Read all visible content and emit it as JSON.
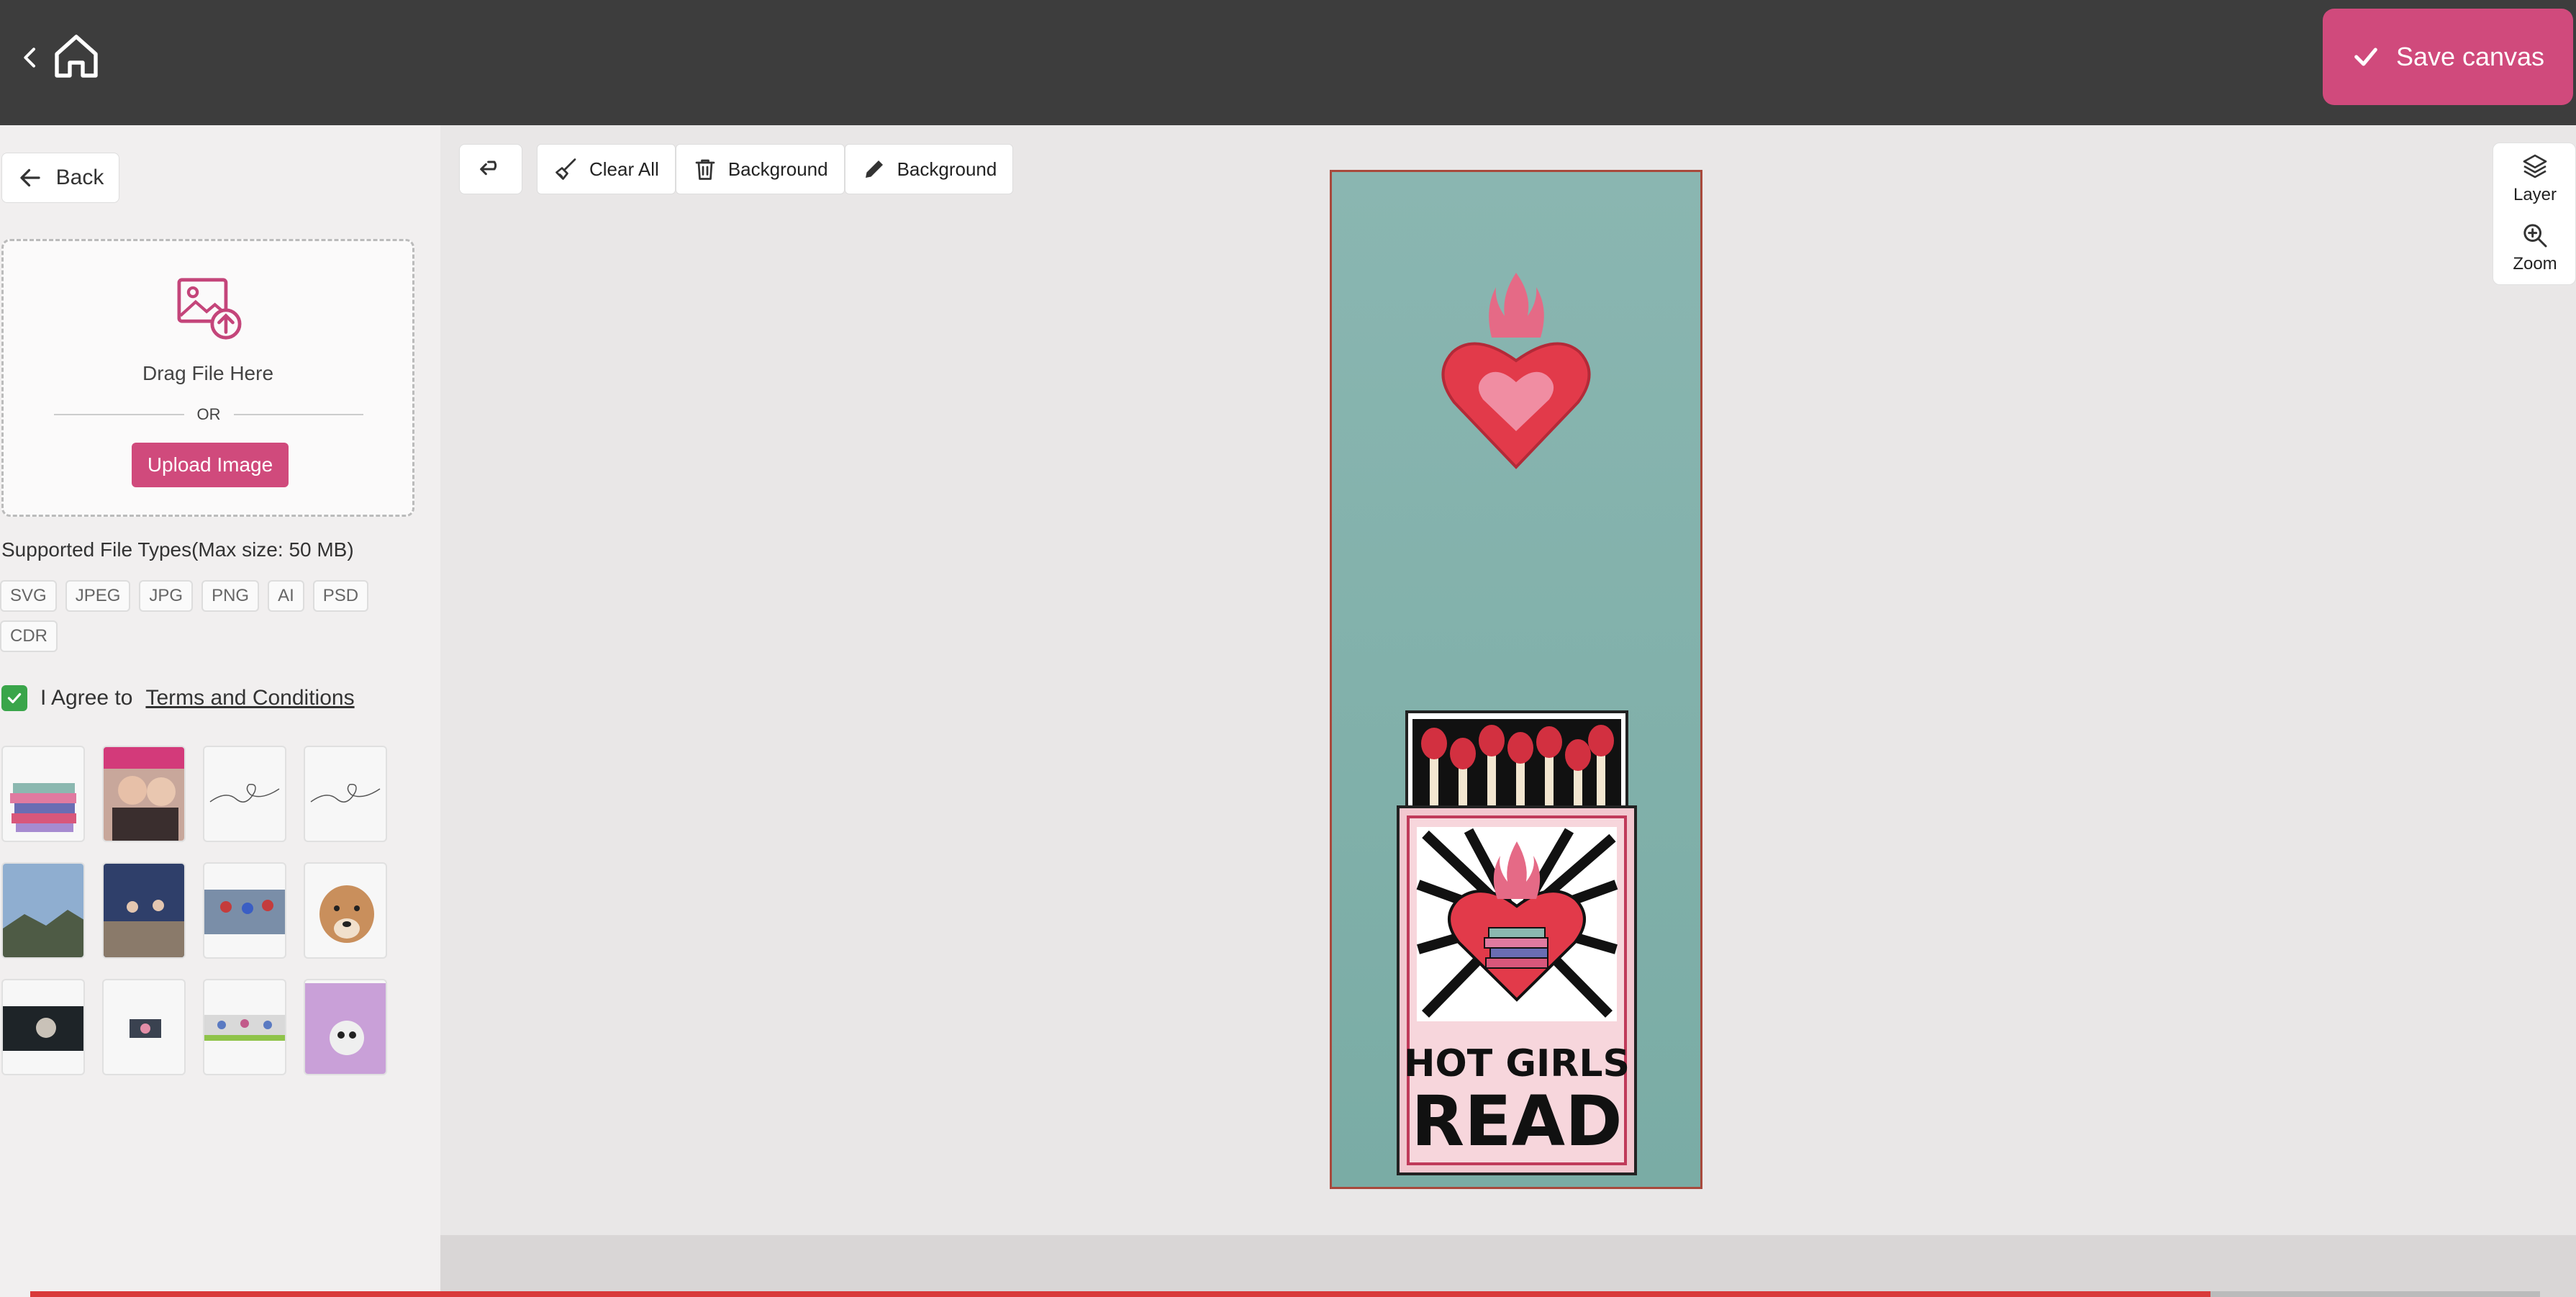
{
  "topbar": {
    "save_label": "Save canvas"
  },
  "sidebar": {
    "back_label": "Back",
    "dropzone": {
      "drag_text": "Drag File Here",
      "or_text": "OR",
      "upload_label": "Upload Image"
    },
    "supported_text": "Supported File Types(Max size: 50 MB)",
    "file_types": [
      "SVG",
      "JPEG",
      "JPG",
      "PNG",
      "AI",
      "PSD",
      "CDR"
    ],
    "agree_text": "I Agree to",
    "terms_text": "Terms and Conditions",
    "agreed": true,
    "thumbnail_count": 12
  },
  "toolbar": {
    "clear_all": "Clear All",
    "remove_background": "Background",
    "edit_background": "Background"
  },
  "right_panel": {
    "layer_label": "Layer",
    "zoom_label": "Zoom"
  },
  "canvas": {
    "artwork_text_line1": "HOT GIRLS",
    "artwork_text_line2": "READ",
    "background_color": "#8ab6b1",
    "border_color": "#a8493c"
  },
  "colors": {
    "accent": "#d04a7c",
    "topbar": "#3d3d3d",
    "checkbox": "#3aa54a"
  },
  "progress": {
    "fraction": 0.86
  }
}
